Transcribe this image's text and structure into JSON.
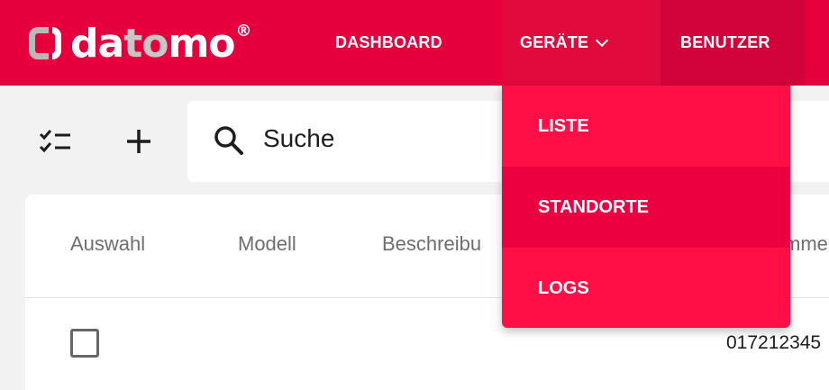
{
  "brand": {
    "logo_text_dato": "dato",
    "logo_text_mo": "mo",
    "registered": "®"
  },
  "nav": {
    "items": [
      {
        "label": "DASHBOARD"
      },
      {
        "label": "GERÄTE"
      },
      {
        "label": "BENUTZER"
      }
    ]
  },
  "dropdown": {
    "items": [
      {
        "label": "LISTE"
      },
      {
        "label": "STANDORTE"
      },
      {
        "label": "LOGS"
      }
    ]
  },
  "toolbar": {
    "search_label": "Suche"
  },
  "table": {
    "headers": [
      "Auswahl",
      "Modell",
      "Beschreibu",
      "mmer"
    ],
    "rows": [
      {
        "checked": false,
        "number": "017212345"
      }
    ]
  },
  "colors": {
    "brand_red": "#e5003d",
    "dropdown_red": "#ff0f45",
    "active_red": "#ec0040",
    "background": "#f2f2f2"
  },
  "icons": {
    "select_mode": "checklist-icon",
    "add": "plus-icon",
    "search": "search-icon",
    "dropdown": "chevron-down-icon"
  }
}
